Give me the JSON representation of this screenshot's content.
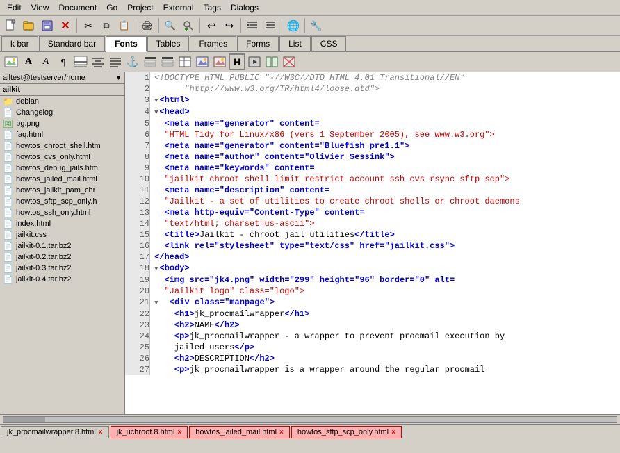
{
  "menubar": {
    "items": [
      "Edit",
      "View",
      "Document",
      "Go",
      "Project",
      "External",
      "Tags",
      "Dialogs"
    ]
  },
  "toolbar1": {
    "buttons": [
      {
        "name": "new-file-btn",
        "icon": "📄",
        "label": "New"
      },
      {
        "name": "open-btn",
        "icon": "📂",
        "label": "Open"
      },
      {
        "name": "save-btn",
        "icon": "💾",
        "label": "Save"
      },
      {
        "name": "close-btn",
        "icon": "✖",
        "label": "Close"
      },
      {
        "name": "cut-btn",
        "icon": "✂",
        "label": "Cut"
      },
      {
        "name": "copy-btn",
        "icon": "📋",
        "label": "Copy"
      },
      {
        "name": "paste-btn",
        "icon": "📌",
        "label": "Paste"
      },
      {
        "name": "print-btn",
        "icon": "🖨",
        "label": "Print"
      },
      {
        "name": "find-btn",
        "icon": "🔍",
        "label": "Find"
      },
      {
        "name": "replace-btn",
        "icon": "🔄",
        "label": "Replace"
      },
      {
        "name": "undo-btn",
        "icon": "↩",
        "label": "Undo"
      },
      {
        "name": "redo-btn",
        "icon": "↪",
        "label": "Redo"
      },
      {
        "name": "align-left-btn",
        "icon": "☰",
        "label": "Align Left"
      },
      {
        "name": "align-right-btn",
        "icon": "☰",
        "label": "Align Right"
      },
      {
        "name": "preview-btn",
        "icon": "🌐",
        "label": "Preview"
      },
      {
        "name": "settings-btn",
        "icon": "🔧",
        "label": "Settings"
      }
    ]
  },
  "tabbar1": {
    "tabs": [
      {
        "label": "k bar",
        "active": false
      },
      {
        "label": "Standard bar",
        "active": false
      },
      {
        "label": "Fonts",
        "active": true
      },
      {
        "label": "Tables",
        "active": false
      },
      {
        "label": "Frames",
        "active": false
      },
      {
        "label": "Forms",
        "active": false
      },
      {
        "label": "List",
        "active": false
      },
      {
        "label": "CSS",
        "active": false
      }
    ]
  },
  "sidebar": {
    "path": "ailtest@testserver/home",
    "title": "ailkit",
    "items": [
      {
        "type": "folder",
        "name": "debian"
      },
      {
        "type": "file-other",
        "name": "Changelog"
      },
      {
        "type": "file-img",
        "name": "bg.png"
      },
      {
        "type": "file-html",
        "name": "faq.html"
      },
      {
        "type": "file-html",
        "name": "howtos_chroot_shell.htm"
      },
      {
        "type": "file-html",
        "name": "howtos_cvs_only.html"
      },
      {
        "type": "file-html",
        "name": "howtos_debug_jails.htm"
      },
      {
        "type": "file-html",
        "name": "howtos_jailed_mail.html"
      },
      {
        "type": "file-html",
        "name": "howtos_jailkit_pam_chr"
      },
      {
        "type": "file-html",
        "name": "howtos_sftp_scp_only.h"
      },
      {
        "type": "file-html",
        "name": "howtos_ssh_only.html"
      },
      {
        "type": "file-html",
        "name": "index.html"
      },
      {
        "type": "file-other",
        "name": "jailkit.css"
      },
      {
        "type": "file-other",
        "name": "jailkit-0.1.tar.bz2"
      },
      {
        "type": "file-other",
        "name": "jailkit-0.2.tar.bz2"
      },
      {
        "type": "file-other",
        "name": "jailkit-0.3.tar.bz2"
      },
      {
        "type": "file-other",
        "name": "jailkit-0.4.tar.bz2"
      }
    ]
  },
  "editor": {
    "lines": [
      {
        "num": 1,
        "content": "<!DOCTYPE HTML PUBLIC \"-//W3C//DTD HTML 4.01 Transitional//EN\"",
        "type": "doctype"
      },
      {
        "num": 2,
        "content": "      \"http://www.w3.org/TR/html4/loose.dtd\">",
        "type": "doctype"
      },
      {
        "num": 3,
        "content": "<html>",
        "type": "tag-fold"
      },
      {
        "num": 4,
        "content": "<head>",
        "type": "tag-fold"
      },
      {
        "num": 5,
        "content": "  <meta name=\"generator\" content=",
        "type": "tag"
      },
      {
        "num": 6,
        "content": "  \"HTML Tidy for Linux/x86 (vers 1 September 2005), see www.w3.org\">",
        "type": "attr-value"
      },
      {
        "num": 7,
        "content": "  <meta name=\"generator\" content=\"Bluefish pre1.1\">",
        "type": "tag"
      },
      {
        "num": 8,
        "content": "  <meta name=\"author\" content=\"Olivier Sessink\">",
        "type": "tag"
      },
      {
        "num": 9,
        "content": "  <meta name=\"keywords\" content=",
        "type": "tag"
      },
      {
        "num": 10,
        "content": "  \"jailkit chroot shell limit restrict account ssh cvs rsync sftp scp\">",
        "type": "attr-value"
      },
      {
        "num": 11,
        "content": "  <meta name=\"description\" content=",
        "type": "tag"
      },
      {
        "num": 12,
        "content": "  \"Jailkit - a set of utilities to create chroot shells or chroot daemons",
        "type": "attr-value"
      },
      {
        "num": 13,
        "content": "  <meta http-equiv=\"Content-Type\" content=",
        "type": "tag"
      },
      {
        "num": 14,
        "content": "  \"text/html; charset=us-ascii\">",
        "type": "attr-value"
      },
      {
        "num": 15,
        "content": "  <title>Jailkit - chroot jail utilities</title>",
        "type": "tag"
      },
      {
        "num": 16,
        "content": "  <link rel=\"stylesheet\" type=\"text/css\" href=\"jailkit.css\">",
        "type": "tag"
      },
      {
        "num": 17,
        "content": "</head>",
        "type": "tag"
      },
      {
        "num": 18,
        "content": "<body>",
        "type": "tag-fold"
      },
      {
        "num": 19,
        "content": "  <img src=\"jk4.png\" width=\"299\" height=\"96\" border=\"0\" alt=",
        "type": "tag"
      },
      {
        "num": 20,
        "content": "  \"Jailkit logo\" class=\"logo\">",
        "type": "attr-value"
      },
      {
        "num": 21,
        "content": "  <div class=\"manpage\">",
        "type": "tag-fold"
      },
      {
        "num": 22,
        "content": "    <h1>jk_procmailwrapper</h1>",
        "type": "tag"
      },
      {
        "num": 23,
        "content": "    <h2>NAME</h2>",
        "type": "tag"
      },
      {
        "num": 24,
        "content": "    <p>jk_procmailwrapper - a wrapper to prevent procmail execution by",
        "type": "tag"
      },
      {
        "num": 25,
        "content": "    jailed users</p>",
        "type": "tag"
      },
      {
        "num": 26,
        "content": "    <h2>DESCRIPTION</h2>",
        "type": "tag"
      },
      {
        "num": 27,
        "content": "    <p>jk_procmailwrapper is a wrapper around the regular procmail",
        "type": "tag"
      }
    ]
  },
  "bottom_tabs": [
    {
      "label": "jk_procmailwrapper.8.html",
      "color": "#d4d0c8"
    },
    {
      "label": "jk_uchroot.8.html",
      "color": "#ff8080"
    },
    {
      "label": "howtos_jailed_mail.html",
      "color": "#ff8080"
    },
    {
      "label": "howtos_sftp_scp_only.html",
      "color": "#ff8080"
    }
  ],
  "icons": {
    "new_doc": "📄",
    "open": "📁",
    "save": "💾",
    "fold_closed": "▶",
    "fold_open": "▼",
    "folder": "📁",
    "file_html": "📄",
    "file_other": "📄",
    "file_img": "🖼",
    "close_x": "×",
    "dropdown": "▼"
  }
}
